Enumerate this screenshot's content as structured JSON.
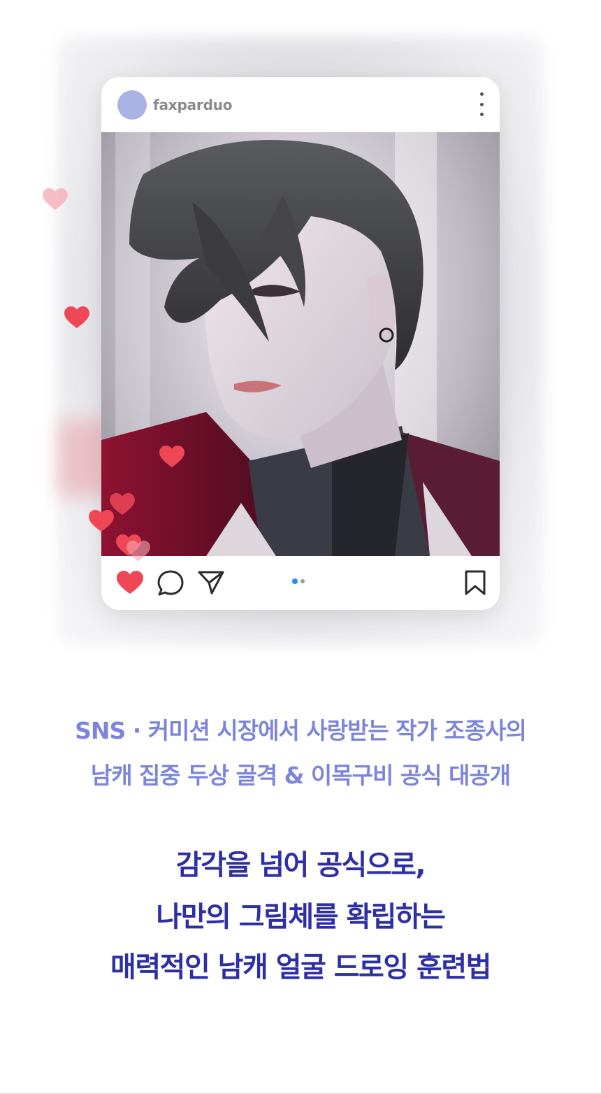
{
  "post": {
    "username": "faxparduo",
    "avatar_color": "#a9b3e4",
    "image_description_icon": "illustration-portrait",
    "actions": {
      "like_icon": "heart-filled-icon",
      "comment_icon": "comment-bubble-icon",
      "share_icon": "paper-plane-icon",
      "bookmark_icon": "bookmark-icon",
      "carousel_pages": 2,
      "carousel_active_index": 0
    }
  },
  "subtitle": {
    "line1": "SNS · 커미션 시장에서 사랑받는 작가 조종사의",
    "line2": "남캐 집중 두상 골격 & 이목구비 공식 대공개"
  },
  "headline": {
    "line1": "감각을 넘어 공식으로,",
    "line2": "나만의 그림체를 확립하는",
    "line3": "매력적인 남캐 얼굴 드로잉 훈련법"
  },
  "colors": {
    "subtitle": "#7c84dc",
    "headline": "#2e2fa3",
    "heart": "#ef4756",
    "carousel_active": "#1e90ff"
  }
}
